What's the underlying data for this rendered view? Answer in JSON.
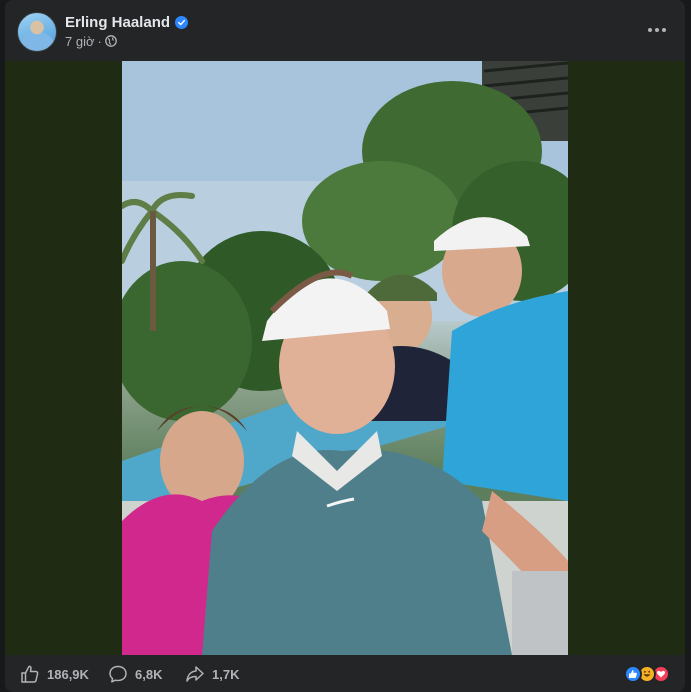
{
  "post": {
    "author": "Erling Haaland",
    "time": "7 giờ",
    "separator": "·",
    "audience_icon": "globe-icon",
    "verified": true
  },
  "photo": {
    "alt_people_count": 4
  },
  "stats": {
    "likes": "186,9K",
    "comments": "6,8K",
    "shares": "1,7K"
  },
  "reactions": [
    "like",
    "haha",
    "love"
  ],
  "colors": {
    "like_blue": "#2d88ff",
    "love_red": "#f33e58",
    "haha_yellow": "#f7b125",
    "card_bg": "#242526",
    "media_bg": "#1f2b12"
  }
}
